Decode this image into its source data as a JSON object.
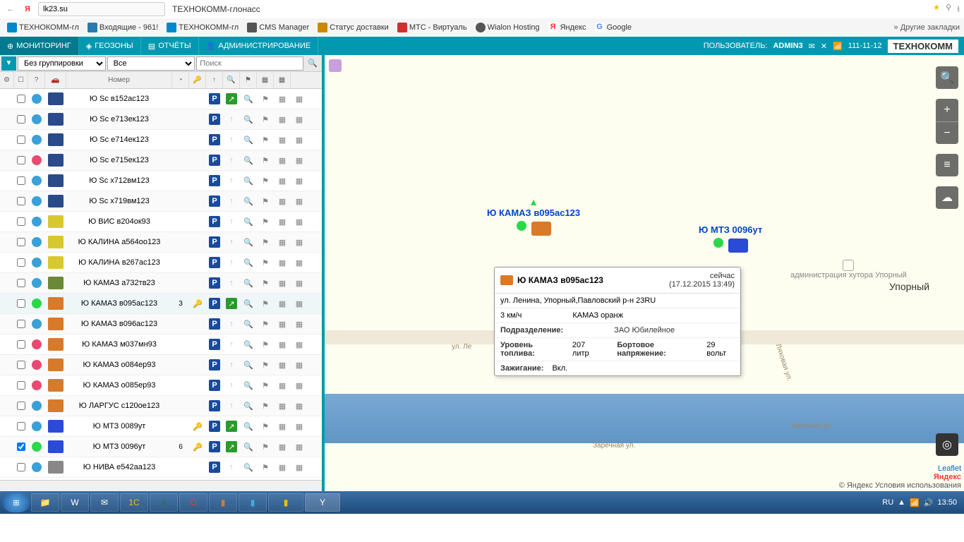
{
  "browser": {
    "url": "lk23.su",
    "title": "ТЕХНОКОММ-глонасс",
    "bookmarks": [
      {
        "label": "ТЕХНОКОММ-гл",
        "color": "#0088cc"
      },
      {
        "label": "Входящие - 961!",
        "color": "#2a7ab0"
      },
      {
        "label": "ТЕХНОКОММ-гл",
        "color": "#0088cc"
      },
      {
        "label": "CMS Manager",
        "color": "#555555"
      },
      {
        "label": "Статус доставки",
        "color": "#cc8800"
      },
      {
        "label": "МТС - Виртуаль",
        "color": "#d32f2f"
      },
      {
        "label": "Wialon Hosting",
        "color": "#555555"
      },
      {
        "label": "Яндекс",
        "color": "#ff0000"
      },
      {
        "label": "Google",
        "color": "#4285f4"
      }
    ],
    "more_bookmarks": "Другие закладки"
  },
  "topnav": {
    "items": [
      "МОНИТОРИНГ",
      "ГЕОЗОНЫ",
      "ОТЧЁТЫ",
      "АДМИНИСТРИРОВАНИЕ"
    ],
    "user_label": "ПОЛЬЗОВАТЕЛЬ:",
    "user": "ADMIN3",
    "phone": "111-11-12",
    "brand": "ТЕХНОКОММ"
  },
  "filters": {
    "group": "Без группировки",
    "all": "Все",
    "search_placeholder": "Поиск"
  },
  "grid": {
    "header": "Номер"
  },
  "vehicles": [
    {
      "name": "Ю Sc в152ас123",
      "status": "#3aa0d8",
      "icon": "#2a4a8a",
      "arrow": "green"
    },
    {
      "name": "Ю Sc е713ек123",
      "status": "#3aa0d8",
      "icon": "#2a4a8a",
      "arrow": "none"
    },
    {
      "name": "Ю Sc е714ек123",
      "status": "#3aa0d8",
      "icon": "#2a4a8a",
      "arrow": "none"
    },
    {
      "name": "Ю Sc е715ек123",
      "status": "#e84a6f",
      "icon": "#2a4a8a",
      "arrow": "none"
    },
    {
      "name": "Ю Sc х712вм123",
      "status": "#3aa0d8",
      "icon": "#2a4a8a",
      "arrow": "none"
    },
    {
      "name": "Ю Sc х719вм123",
      "status": "#3aa0d8",
      "icon": "#2a4a8a",
      "arrow": "none"
    },
    {
      "name": "Ю ВИС в204ок93",
      "status": "#3aa0d8",
      "icon": "#d8c830",
      "arrow": "none"
    },
    {
      "name": "Ю КАЛИНА а564оо123",
      "status": "#3aa0d8",
      "icon": "#d8c830",
      "arrow": "none"
    },
    {
      "name": "Ю КАЛИНА в267ас123",
      "status": "#3aa0d8",
      "icon": "#d8c830",
      "arrow": "none"
    },
    {
      "name": "Ю КАМАЗ а732тв23",
      "status": "#3aa0d8",
      "icon": "#6a8a3a",
      "arrow": "none"
    },
    {
      "name": "Ю КАМАЗ в095ас123",
      "status": "#2ad84a",
      "icon": "#d87a2a",
      "arrow": "green",
      "badge": "3",
      "key": true,
      "sel": true
    },
    {
      "name": "Ю КАМАЗ в096ас123",
      "status": "#3aa0d8",
      "icon": "#d87a2a",
      "arrow": "none"
    },
    {
      "name": "Ю КАМАЗ м037мн93",
      "status": "#e84a6f",
      "icon": "#d87a2a",
      "arrow": "none"
    },
    {
      "name": "Ю КАМАЗ о084ер93",
      "status": "#e84a6f",
      "icon": "#d87a2a",
      "arrow": "none"
    },
    {
      "name": "Ю КАМАЗ о085ер93",
      "status": "#e84a6f",
      "icon": "#d87a2a",
      "arrow": "none"
    },
    {
      "name": "Ю ЛАРГУС с120ое123",
      "status": "#3aa0d8",
      "icon": "#d87a2a",
      "arrow": "none"
    },
    {
      "name": "Ю МТЗ 0089ут",
      "status": "#3aa0d8",
      "icon": "#2a4ad8",
      "arrow": "green",
      "key": true
    },
    {
      "name": "Ю МТЗ 0096ут",
      "status": "#2ad84a",
      "icon": "#2a4ad8",
      "arrow": "green",
      "badge": "6",
      "key": true,
      "checked": true
    },
    {
      "name": "Ю НИВА е542аа123",
      "status": "#3aa0d8",
      "icon": "#888888",
      "arrow": "none"
    }
  ],
  "map": {
    "unit1": {
      "label": "Ю КАМАЗ в095ас123"
    },
    "unit2": {
      "label": "Ю МТЗ 0096ут"
    },
    "place1": "Упорный",
    "place2": "администрация хутора Упорный",
    "street1": "ул. Ле",
    "street2": "Ляховая ул.",
    "street3": "Заречная ул.",
    "street4": "Заречная ул.",
    "attr_leaflet": "Leaflet",
    "attr_yandex": "Яндекс",
    "attr_full": "© Яндекс  Условия использования"
  },
  "tooltip": {
    "title": "Ю КАМАЗ в095ас123",
    "now": "сейчас",
    "ts": "(17.12.2015 13:49)",
    "addr": "ул. Ленина, Упорный,Павловский р-н 23RU",
    "speed": "3 км/ч",
    "model": "КАМАЗ оранж",
    "dept_label": "Подразделение:",
    "dept": "ЗАО Юбилейное",
    "fuel_label": "Уровень топлива:",
    "fuel": "207 литр",
    "volt_label": "Бортовое напряжение:",
    "volt": "29 вольт",
    "ign_label": "Зажигание:",
    "ign": "Вкл."
  },
  "taskbar": {
    "lang": "RU",
    "clock": "13:50"
  }
}
